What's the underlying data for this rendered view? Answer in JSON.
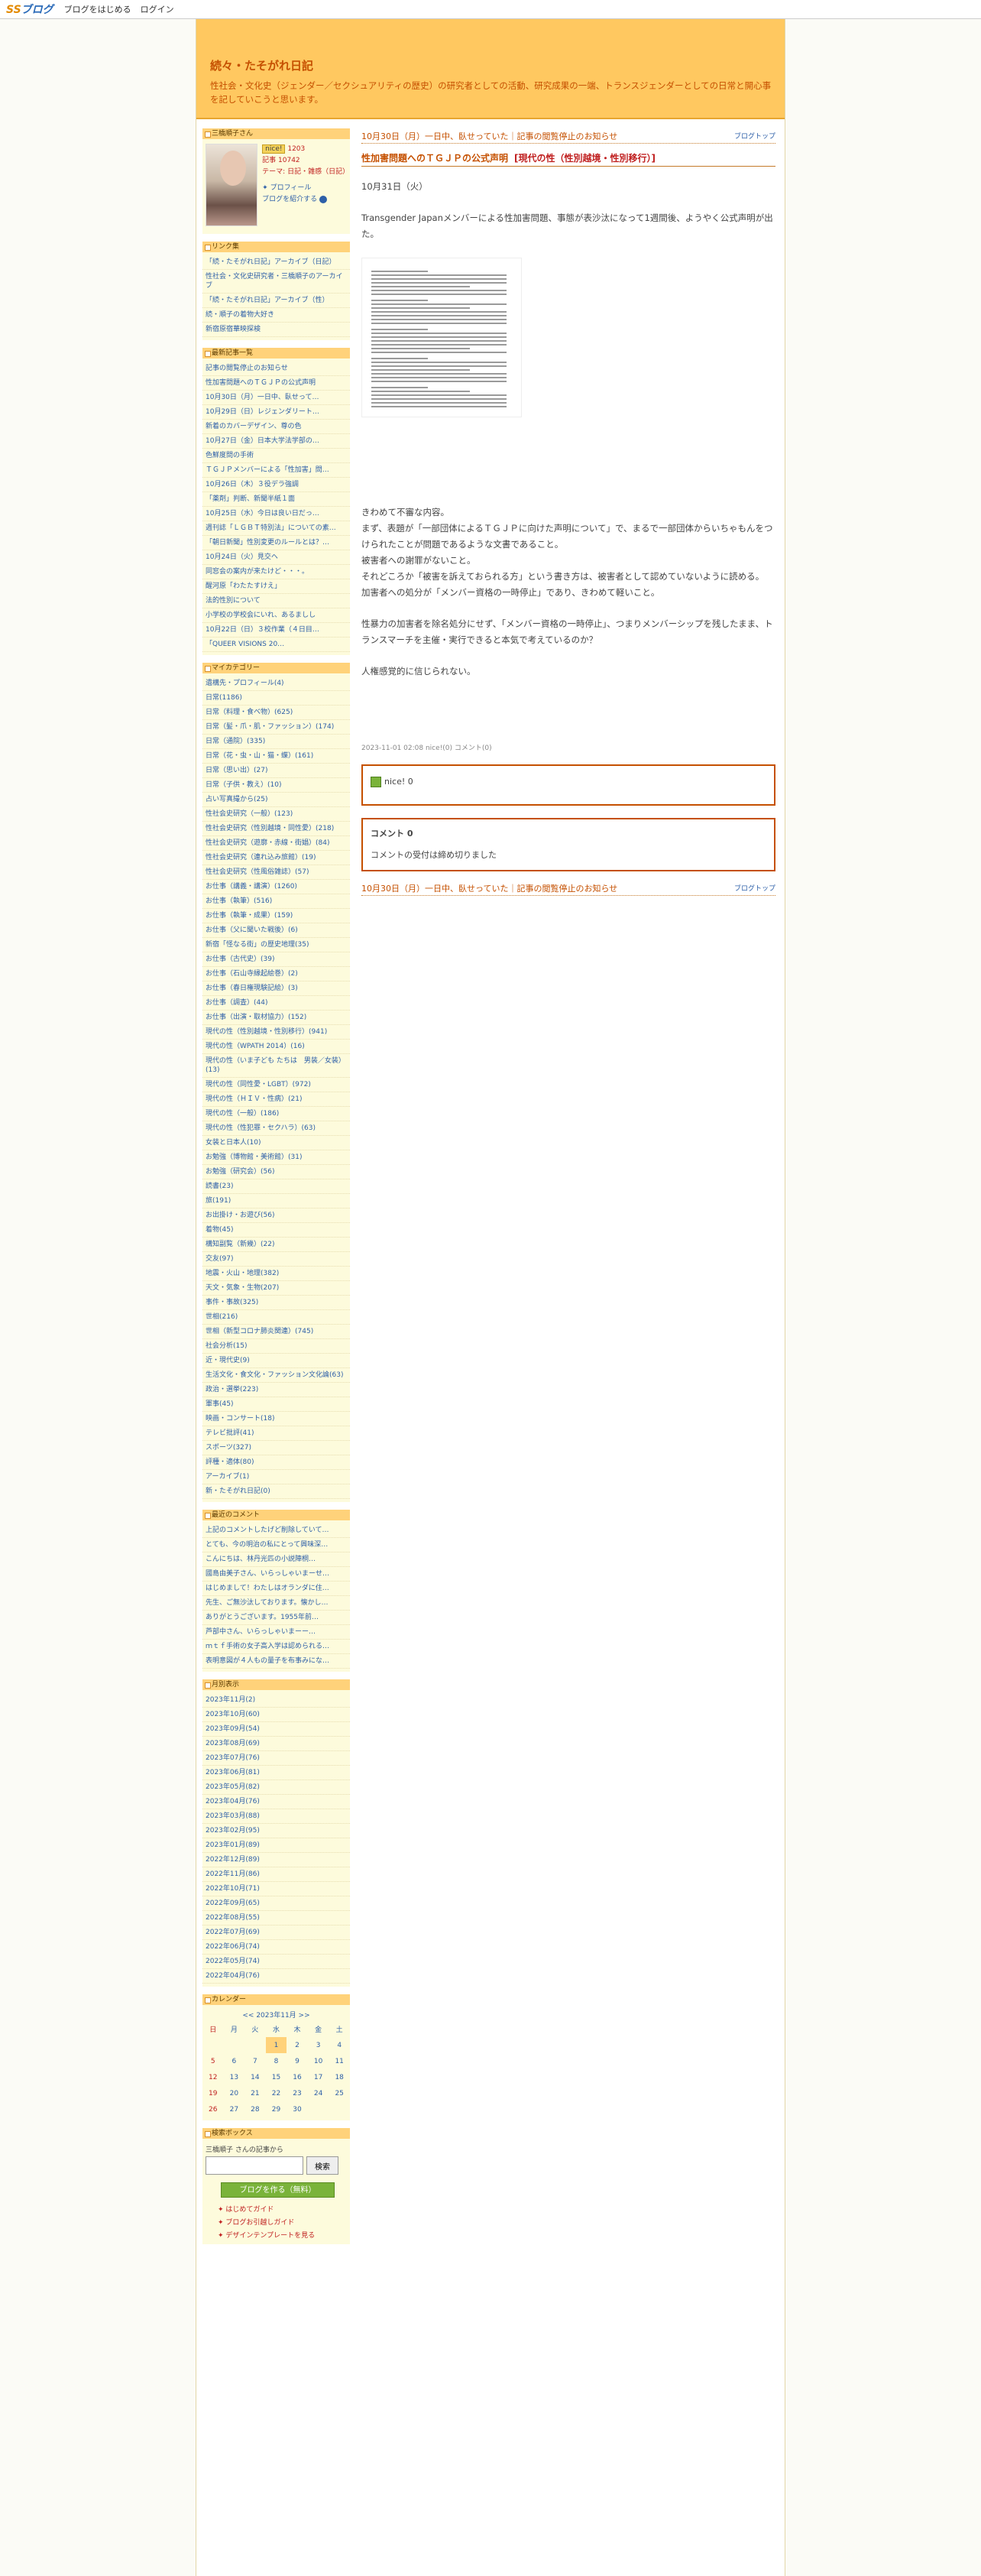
{
  "topbar": {
    "logo_a": "SS",
    "logo_b": "ブログ",
    "start": "ブログをはじめる",
    "login": "ログイン"
  },
  "blog": {
    "title": "続々・たそがれ日記",
    "desc": "性社会・文化史（ジェンダー／セクシュアリティの歴史）の研究者としての活動、研究成果の一端、トランスジェンダーとしての日常と開心事を記していこうと思います。"
  },
  "profile": {
    "head": "三橋順子さん",
    "nice": "nice!",
    "nice_count": "1203",
    "posts": "記事 10742",
    "theme": "テーマ: 日記・雑感（日記）",
    "profile_link": "✦ プロフィール",
    "share": "ブログを紹介する"
  },
  "links": {
    "head": "リンク集",
    "items": [
      "「続・たそがれ日記」アーカイブ（日記）",
      "性社会・文化史研究者・三橋順子のアーカイブ",
      "「続・たそがれ日記」アーカイブ（性）",
      "続・順子の着物大好き",
      "新宿原宿華映探検"
    ]
  },
  "recent": {
    "head": "最新記事一覧",
    "items": [
      "記事の閲覧停止のお知らせ",
      "性加害問題へのＴＧＪＰの公式声明",
      "10月30日（月）一日中、臥せって…",
      "10月29日（日）レジェンダリート…",
      "新着のカバーデザイン、尊の色",
      "10月27日（金）日本大学法学部の…",
      "色鮮度問の手術",
      "ＴＧＪＰメンバーによる「性加害」問…",
      "10月26日（木）３役デラ強調",
      "「薬剤」判断、新聞半紙１面",
      "10月25日（水）今日は良い日だっ…",
      "週刊誌「ＬＧＢＴ特別法」についての素…",
      "「朝日新聞」性別変更のルールとは？…",
      "10月24日（火）見交ヘ",
      "同窓会の案内が来たけど・・・。",
      "醒河原「わたたすけえ」",
      "法的性別について",
      "小学校の学校会にいれ、あるましし",
      "10月22日（日）３校作業（４日目…",
      "「QUEER VISIONS 20…"
    ]
  },
  "cats": {
    "head": "マイカテゴリー",
    "items": [
      "遺構先・プロフィール(4)",
      "日常(1186)",
      "日常（料理・食べ物）(625)",
      "日常（髪・爪・肌・ファッション）(174)",
      "日常（通院）(335)",
      "日常（花・虫・山・猫・蝶）(161)",
      "日常（思い出）(27)",
      "日常（子供・教え）(10)",
      "占い写真撮から(25)",
      "性社会史研究（一般）(123)",
      "性社会史研究（性別越境・同性愛）(218)",
      "性社会史研究（遊廓・赤線・街娼）(84)",
      "性社会史研究（連れ込み旅館）(19)",
      "性社会史研究（性風俗雑誌）(57)",
      "お仕事（講義・講演）(1260)",
      "お仕事（執筆）(516)",
      "お仕事（執筆・成果）(159)",
      "お仕事（父に聞いた戦後）(6)",
      "新宿「怪なる街」の歴史地理(35)",
      "お仕事（古代史）(39)",
      "お仕事（石山寺縁起絵巻）(2)",
      "お仕事（春日権現験記絵）(3)",
      "お仕事（調査）(44)",
      "お仕事（出演・取材協力）(152)",
      "現代の性（性別越境・性別移行）(941)",
      "現代の性（WPATH 2014）(16)",
      "現代の性（いま子ども たちは　男装／女装）(13)",
      "現代の性（同性愛・LGBT）(972)",
      "現代の性（ＨＩＶ・性病）(21)",
      "現代の性（一般）(186)",
      "現代の性（性犯罪・セクハラ）(63)",
      "女装と日本人(10)",
      "お勉強（博物館・美術館）(31)",
      "お勉強（研究会）(56)",
      "読書(23)",
      "旅(191)",
      "お出掛け・お遊び(56)",
      "着物(45)",
      "構知副覧（新幾）(22)",
      "交友(97)",
      "地震・火山・地理(382)",
      "天文・気象・生物(207)",
      "事件・事故(325)",
      "世相(216)",
      "世相（新型コロナ肺炎関連）(745)",
      "社会分析(15)",
      "近・現代史(9)",
      "生活文化・食文化・ファッション文化論(63)",
      "政治・選挙(223)",
      "軍事(45)",
      "映画・コンサート(18)",
      "テレビ批評(41)",
      "スポーツ(327)",
      "評種・適体(80)",
      "アーカイブ(1)",
      "新・たそがれ日記(0)"
    ]
  },
  "comments": {
    "head": "最近のコメント",
    "items": [
      "上記のコメントしたげど削除していて…",
      "とても、今の明治の私にとって興味深…",
      "こんにちは、林丹光匹の小説陣桐…",
      "國島由美子さん、いらっしゃいまーせ…",
      "はじめまして！わたしはオランダに住…",
      "先生、ご無沙汰しております。懐かし…",
      "ありがとうございます。1955年前…",
      "芦部中さん、いらっしゃいまーー…",
      "ｍｔｆ手術の女子高入学は認められる…",
      "表明意図が４人もの量子を布事みにな…"
    ]
  },
  "archive": {
    "head": "月別表示",
    "items": [
      "2023年11月(2)",
      "2023年10月(60)",
      "2023年09月(54)",
      "2023年08月(69)",
      "2023年07月(76)",
      "2023年06月(81)",
      "2023年05月(82)",
      "2023年04月(76)",
      "2023年03月(88)",
      "2023年02月(95)",
      "2023年01月(89)",
      "2022年12月(89)",
      "2022年11月(86)",
      "2022年10月(71)",
      "2022年09月(65)",
      "2022年08月(55)",
      "2022年07月(69)",
      "2022年06月(74)",
      "2022年05月(74)",
      "2022年04月(76)"
    ]
  },
  "calendar": {
    "head": "カレンダー",
    "month": "<< 2023年11月 >>",
    "dows": [
      "日",
      "月",
      "火",
      "水",
      "木",
      "金",
      "土"
    ],
    "rows": [
      [
        "",
        "",
        "",
        "1",
        "2",
        "3",
        "4"
      ],
      [
        "5",
        "6",
        "7",
        "8",
        "9",
        "10",
        "11"
      ],
      [
        "12",
        "13",
        "14",
        "15",
        "16",
        "17",
        "18"
      ],
      [
        "19",
        "20",
        "21",
        "22",
        "23",
        "24",
        "25"
      ],
      [
        "26",
        "27",
        "28",
        "29",
        "30",
        "",
        ""
      ]
    ],
    "today": "1"
  },
  "search": {
    "head": "検索ボックス",
    "label": "三橋順子 さんの記事から",
    "button": "検索"
  },
  "promo": {
    "make": "ブログを作る（無料）",
    "g1": "✦ はじめてガイド",
    "g2": "✦ ブログお引越しガイド",
    "g3": "✦ デザインテンプレートを見る"
  },
  "article": {
    "prev": "10月30日（月）一日中、臥せっていた｜記事の閲覧停止のお知らせ",
    "top": "ブログトップ",
    "title": "性加害問題へのＴＧＪＰの公式声明",
    "cat": "[現代の性（性別越境・性別移行）]",
    "date": "10月31日（火）",
    "p1": "Transgender Japanメンバーによる性加害問題、事態が表沙汰になって1週間後、ようやく公式声明が出た。",
    "b1": "きわめて不審な内容。",
    "b2": "まず、表題が「一部団体によるＴＧＪＰに向けた声明について」で、まるで一部団体からいちゃもんをつけられたことが問題であるような文書であること。",
    "b3": "被害者への謝罪がないこと。",
    "b4": "それどころか「被害を訴えておられる方」という書き方は、被害者として認めていないように読める。",
    "b5": "加害者への処分が「メンバー資格の一時停止」であり、きわめて軽いこと。",
    "c1": "性暴力の加害者を除名処分にせず、「メンバー資格の一時停止」、つまりメンバーシップを残したまま、トランスマーチを主催・実行できると本気で考えているのか？",
    "c2": "人権感覚的に信じられない。",
    "meta": "2023-11-01 02:08 nice!(0) コメント(0)",
    "nice": "nice! 0",
    "comments_head": "コメント 0",
    "comments_closed": "コメントの受付は締め切りました"
  }
}
